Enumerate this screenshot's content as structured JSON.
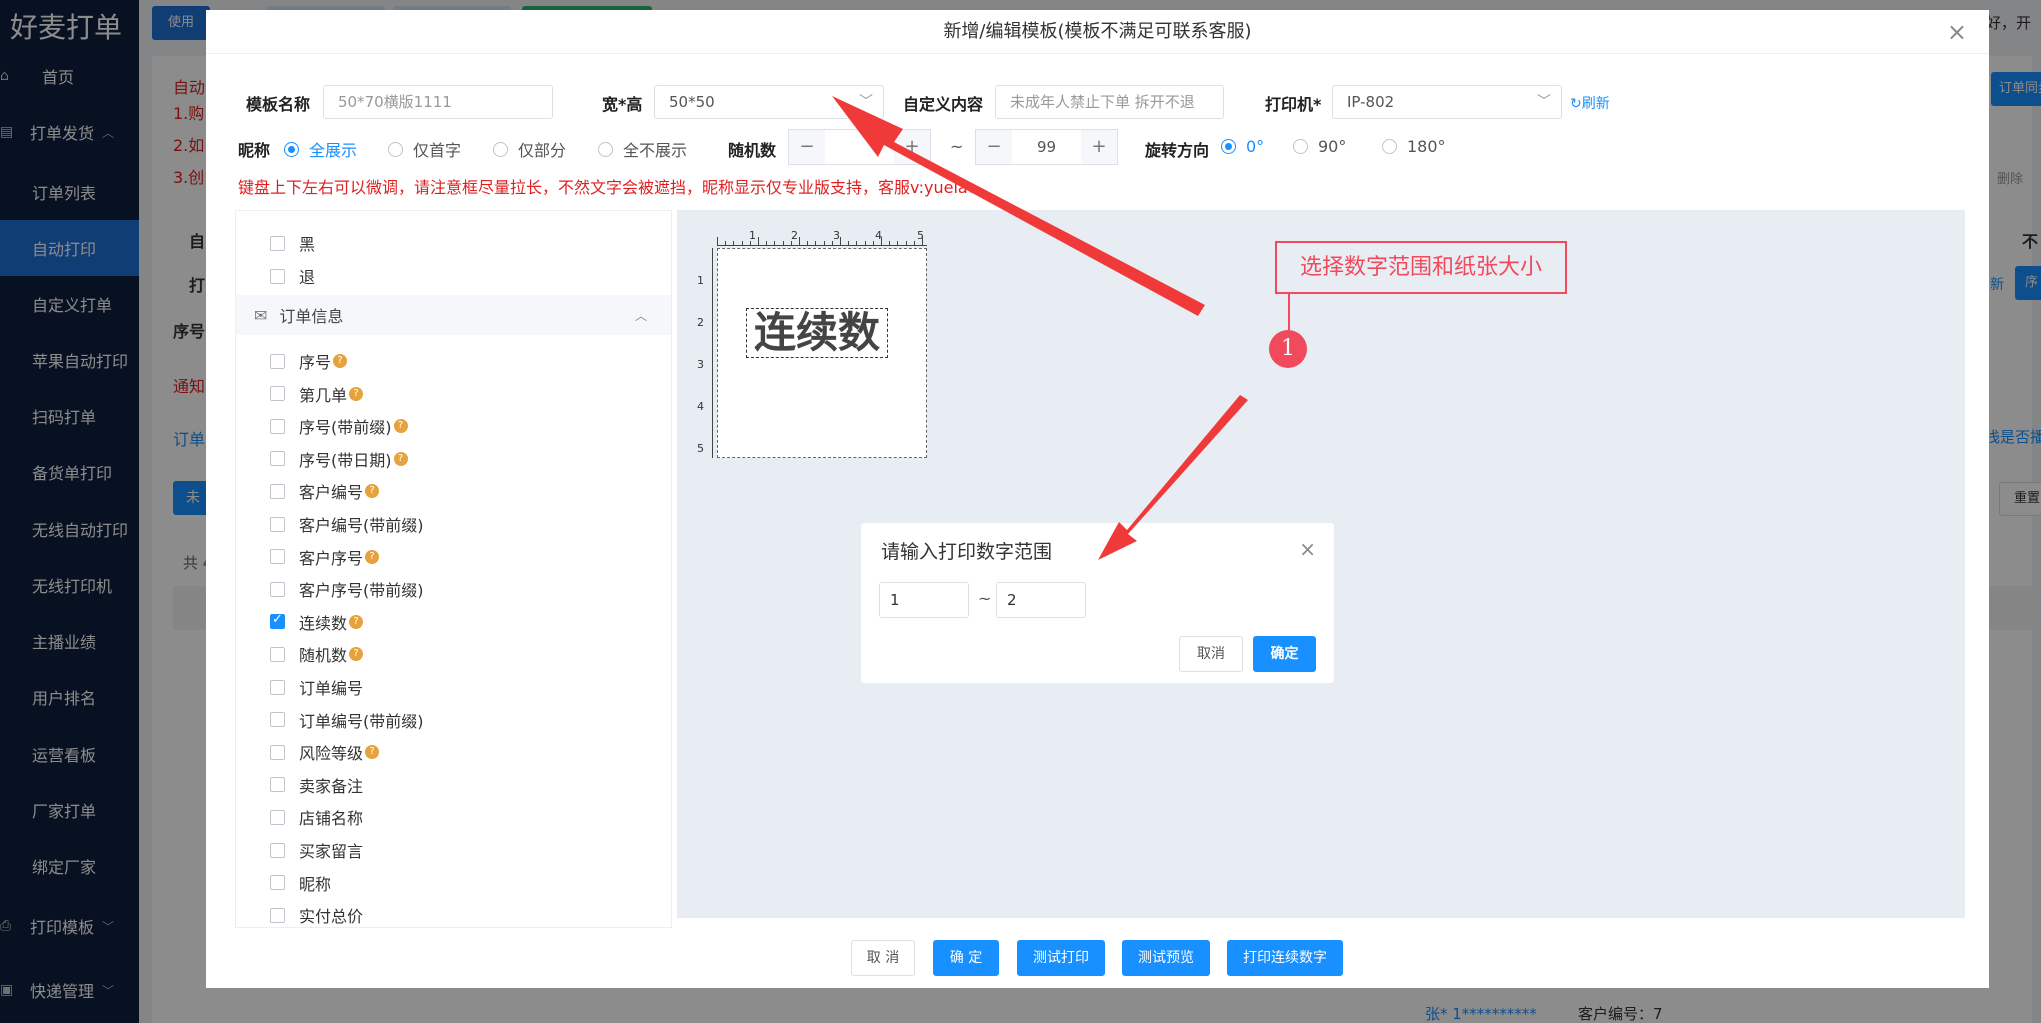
{
  "sidebar": {
    "logo": "好麦打单",
    "items": [
      {
        "label": "首页",
        "type": "top",
        "icon": "home-icon",
        "active": false
      },
      {
        "label": "打单发货",
        "type": "top",
        "icon": "list-icon",
        "active": false,
        "chevron": "︿"
      },
      {
        "label": "订单列表",
        "type": "sub",
        "active": false
      },
      {
        "label": "自动打印",
        "type": "sub",
        "active": true
      },
      {
        "label": "自定义打单",
        "type": "sub",
        "active": false
      },
      {
        "label": "苹果自动打印",
        "type": "sub",
        "active": false
      },
      {
        "label": "扫码打单",
        "type": "sub",
        "active": false
      },
      {
        "label": "备货单打印",
        "type": "sub",
        "active": false
      },
      {
        "label": "无线自动打印",
        "type": "sub",
        "active": false
      },
      {
        "label": "无线打印机",
        "type": "sub",
        "active": false
      },
      {
        "label": "主播业绩",
        "type": "sub",
        "active": false
      },
      {
        "label": "用户排名",
        "type": "sub",
        "active": false
      },
      {
        "label": "运营看板",
        "type": "sub",
        "active": false
      },
      {
        "label": "厂家打单",
        "type": "sub",
        "active": false
      },
      {
        "label": "绑定厂家",
        "type": "sub",
        "active": false
      },
      {
        "label": "打印模板",
        "type": "top",
        "icon": "print-icon",
        "active": false,
        "chevron": "﹀"
      },
      {
        "label": "快递管理",
        "type": "top",
        "icon": "box-icon",
        "active": false,
        "chevron": "﹀"
      }
    ]
  },
  "background": {
    "top_button": "使用",
    "left_texts": [
      "自动",
      "1.购",
      "2.如",
      "3.创"
    ],
    "mid_texts": [
      "自",
      "打",
      "序号"
    ],
    "notice": "通知",
    "tab": "订单",
    "btn_blue": "未",
    "count": "共 4",
    "right_greeting": "好，开",
    "right_sync": "订单同步",
    "right_del": "删除",
    "right_no": "不",
    "right_xin": "新",
    "right_xu": "序",
    "right_check": "浅是否播",
    "right_reset": "重置",
    "footer_mid": "张* 1**********",
    "footer_customer": "客户编号：7"
  },
  "modal": {
    "title": "新增/编辑模板(模板不满足可联系客服)",
    "template_name_label": "模板名称",
    "template_name_placeholder": "50*70横版1111",
    "size_label": "宽*高",
    "size_value": "50*50",
    "custom_label": "自定义内容",
    "custom_placeholder": "未成年人禁止下单 拆开不退",
    "printer_label": "打印机*",
    "printer_value": "IP-802",
    "refresh": "刷新",
    "nickname_label": "昵称",
    "nickname_options": [
      "全展示",
      "仅首字",
      "仅部分",
      "全不展示"
    ],
    "nickname_selected": 0,
    "random_label": "随机数",
    "random_max": "99",
    "random_tilde": "~",
    "rotate_label": "旋转方向",
    "rotate_options": [
      "0°",
      "90°",
      "180°"
    ],
    "rotate_selected": 0,
    "warning": "键盘上下左右可以微调，请注意框尽量拉长，不然文字会被遮挡，昵称显示仅专业版支持，客服v:yuelao"
  },
  "field_list": {
    "top_items": [
      {
        "label": "黑",
        "checked": false
      },
      {
        "label": "退",
        "checked": false
      }
    ],
    "group_title": "订单信息",
    "items": [
      {
        "label": "序号",
        "checked": false,
        "help": true
      },
      {
        "label": "第几单",
        "checked": false,
        "help": true
      },
      {
        "label": "序号(带前缀)",
        "checked": false,
        "help": true
      },
      {
        "label": "序号(带日期)",
        "checked": false,
        "help": true
      },
      {
        "label": "客户编号",
        "checked": false,
        "help": true
      },
      {
        "label": "客户编号(带前缀)",
        "checked": false,
        "help": false
      },
      {
        "label": "客户序号",
        "checked": false,
        "help": true
      },
      {
        "label": "客户序号(带前缀)",
        "checked": false,
        "help": false
      },
      {
        "label": "连续数",
        "checked": true,
        "help": true
      },
      {
        "label": "随机数",
        "checked": false,
        "help": true
      },
      {
        "label": "订单编号",
        "checked": false,
        "help": false
      },
      {
        "label": "订单编号(带前缀)",
        "checked": false,
        "help": false
      },
      {
        "label": "风险等级",
        "checked": false,
        "help": true
      },
      {
        "label": "卖家备注",
        "checked": false,
        "help": false
      },
      {
        "label": "店铺名称",
        "checked": false,
        "help": false
      },
      {
        "label": "买家留言",
        "checked": false,
        "help": false
      },
      {
        "label": "昵称",
        "checked": false,
        "help": false
      },
      {
        "label": "实付总价",
        "checked": false,
        "help": false
      }
    ]
  },
  "canvas": {
    "ruler_top": [
      "1",
      "2",
      "3",
      "4",
      "5"
    ],
    "ruler_left": [
      "1",
      "2",
      "3",
      "4",
      "5"
    ],
    "element_text": "连续数"
  },
  "footer_buttons": {
    "cancel": "取 消",
    "ok": "确 定",
    "test_print": "测试打印",
    "test_preview": "测试预览",
    "print_continuous": "打印连续数字"
  },
  "range_dialog": {
    "title": "请输入打印数字范围",
    "from": "1",
    "to": "2",
    "tilde": "~",
    "cancel": "取消",
    "ok": "确定"
  },
  "annotation": {
    "text": "选择数字范围和纸张大小",
    "badge": "1",
    "color": "#f04a5c"
  }
}
